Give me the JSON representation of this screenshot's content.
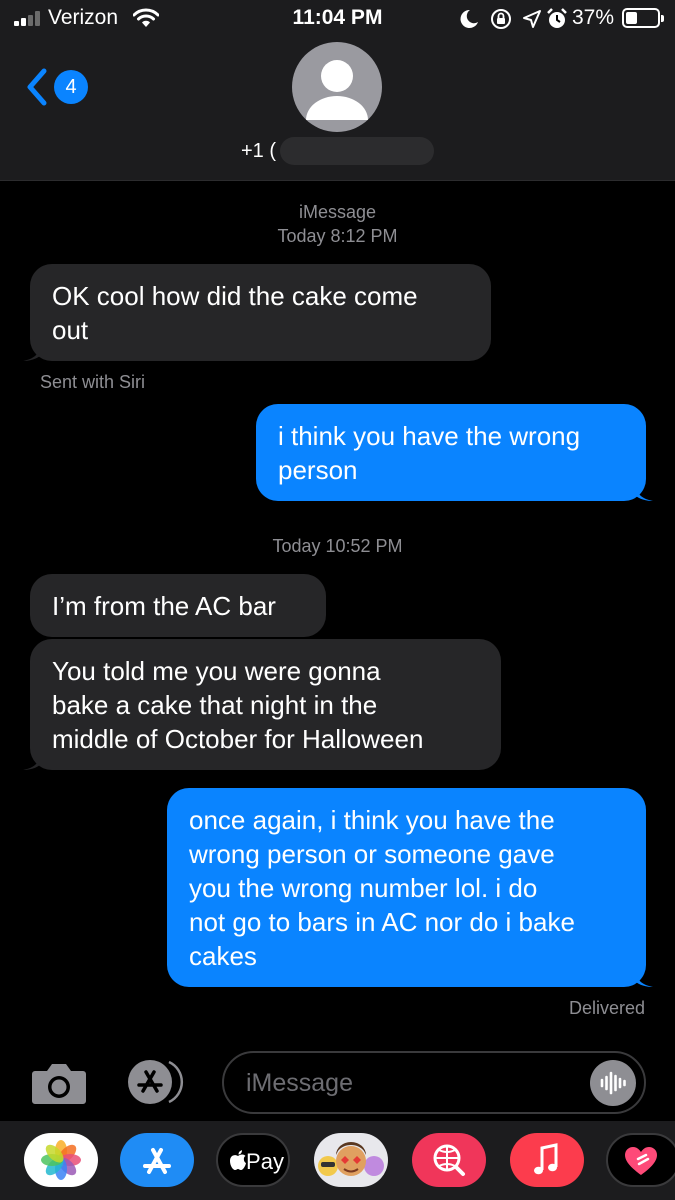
{
  "status_bar": {
    "carrier": "Verizon",
    "time": "11:04 PM",
    "battery_percent": "37%",
    "battery_level": 0.37,
    "signal_bars": 2,
    "icons": [
      "wifi-icon",
      "moon-icon",
      "rotation-lock-icon",
      "location-icon",
      "alarm-icon",
      "battery-icon"
    ]
  },
  "header": {
    "back_count": "4",
    "contact_prefix": "+1 (",
    "avatar_icon": "person-silhouette-icon"
  },
  "conversation": {
    "service_label": "iMessage",
    "timestamp_1": "Today 8:12 PM",
    "message_1": "OK cool how did the cake come\nout",
    "message_1_note": "Sent with Siri",
    "message_2": "i think you have the wrong\nperson",
    "timestamp_2": "Today 10:52 PM",
    "message_3": "I’m from the AC bar",
    "message_4": "You told me you were gonna\nbake a cake that night in the\nmiddle of October for Halloween",
    "message_5": "once again, i think you have the\nwrong person or someone gave\nyou the wrong number lol. i do\nnot go to bars in AC nor do i bake\ncakes",
    "delivery_status": "Delivered"
  },
  "input_bar": {
    "placeholder": "iMessage"
  },
  "app_drawer": {
    "applepay_label": "Pay",
    "apps": [
      "photos-app",
      "app-store-app",
      "apple-pay-app",
      "memoji-app",
      "web-search-app",
      "music-app",
      "digital-touch-app"
    ]
  },
  "colors": {
    "background": "#000000",
    "bar_background": "#1c1c1e",
    "incoming_bubble": "#262628",
    "outgoing_bubble": "#0a84ff",
    "secondary_text": "#8e8e93"
  }
}
